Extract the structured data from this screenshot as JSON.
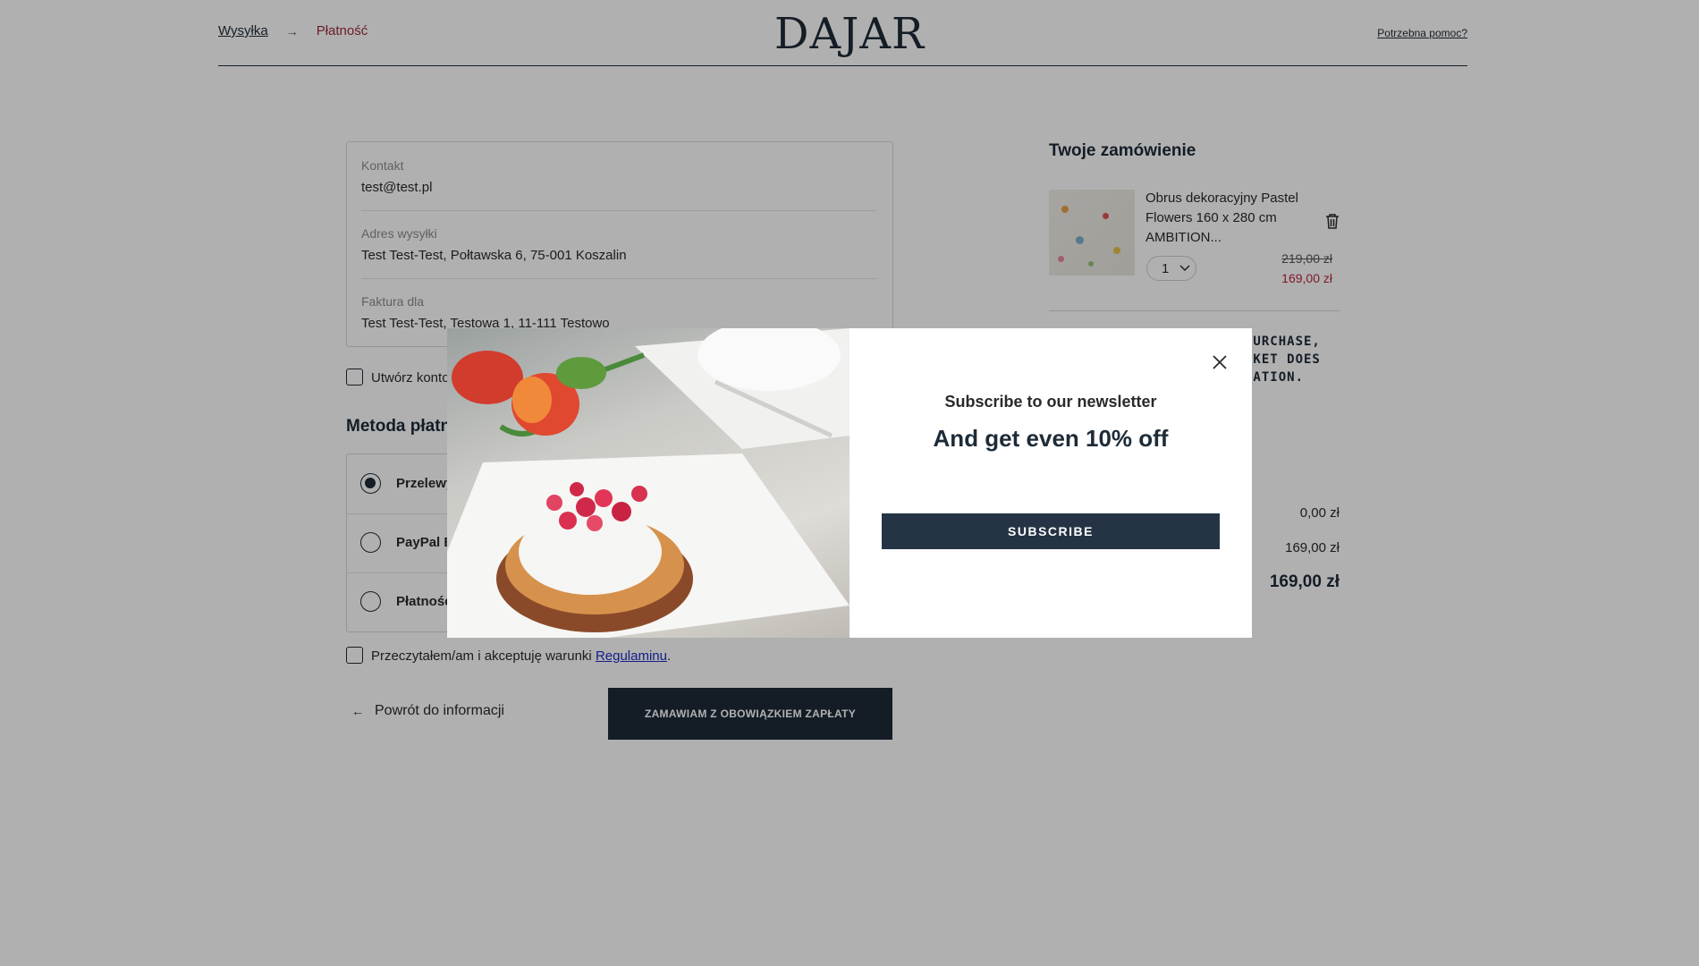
{
  "header": {
    "breadcrumb_shipping": "Wysyłka",
    "breadcrumb_arrow": "→",
    "breadcrumb_payment": "Płatność",
    "logo": "DAJAR",
    "help": "Potrzebna pomoc?"
  },
  "info": {
    "contact_label": "Kontakt",
    "contact_value": "test@test.pl",
    "shipping_label": "Adres wysyłki",
    "shipping_value": "Test Test-Test, Połtawska 6, 75-001 Koszalin",
    "invoice_label": "Faktura dla",
    "invoice_value": "Test Test-Test, Testowa 1, 11-111 Testowo"
  },
  "create_account": {
    "label": "Utwórz konto"
  },
  "payment": {
    "title": "Metoda płatn",
    "methods": [
      {
        "label": "Przelewy",
        "selected": true
      },
      {
        "label": "PayPal E",
        "selected": false
      },
      {
        "label": "Płatność",
        "selected": false
      }
    ]
  },
  "terms": {
    "text_before": "Przeczytałem/am i akceptuję warunki ",
    "link": "Regulaminu",
    "text_after": "."
  },
  "footer_actions": {
    "back_arrow": "←",
    "back_label": "Powrót do informacji",
    "order_button": "ZAMAWIAM Z OBOWIĄZKIEM ZAPŁATY"
  },
  "summary": {
    "title": "Twoje zamówienie",
    "product": {
      "name": "Obrus dekoracyjny Pastel Flowers 160 x 280 cm AMBITION...",
      "quantity": "1",
      "old_price": "219,00 zł",
      "new_price": "169,00 zł"
    },
    "promo_lines": [
      "PURCHASE,",
      "SKET DOES",
      "VATION."
    ],
    "shipping_cost": "0,00 zł",
    "subtotal": "169,00 zł",
    "total": "169,00 zł"
  },
  "modal": {
    "subtitle": "Subscribe to our newsletter",
    "heading": "And get even 10% off",
    "button": "SUBSCRIBE"
  },
  "colors": {
    "brand_navy": "#1e2b38",
    "sale_red": "#b5283c",
    "link_blue": "#1d2bc4"
  }
}
